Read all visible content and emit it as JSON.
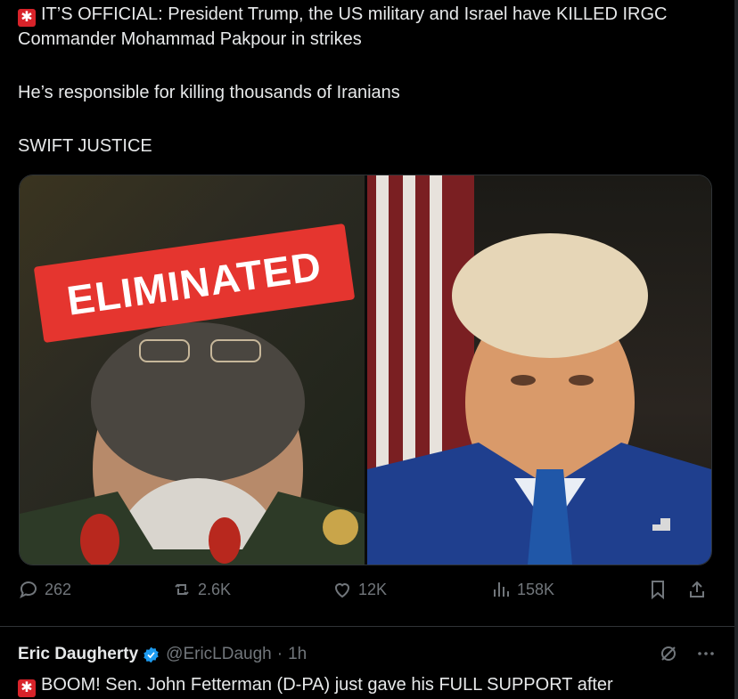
{
  "tweet": {
    "line1": "IT’S OFFICIAL: President Trump, the US military and Israel have KILLED IRGC Commander Mohammad Pakpour in strikes",
    "line2": "He’s responsible for killing thousands of Iranians",
    "line3": "SWIFT JUSTICE",
    "icons": {
      "siren": "rotating-light-icon"
    }
  },
  "media": {
    "stamp_text": "ELIMINATED",
    "left_photo": "photo-of-commander",
    "right_photo": "photo-of-president"
  },
  "actions": {
    "replies": "262",
    "reposts": "2.6K",
    "likes": "12K",
    "views": "158K"
  },
  "next_tweet": {
    "author": "Eric Daugherty",
    "handle": "@EricLDaugh",
    "sep": "·",
    "time": "1h",
    "text": "BOOM! Sen. John Fetterman (D-PA) just gave his FULL SUPPORT after",
    "icons": {
      "siren": "rotating-light-icon",
      "verified": "verified-badge-icon",
      "grok": "grok-icon",
      "more": "more-icon"
    }
  },
  "colors": {
    "background": "#000000",
    "text": "#e7e9ea",
    "muted": "#71767b",
    "verified": "#1d9bf0",
    "stamp": "#e5352f",
    "siren": "#d8232a"
  }
}
